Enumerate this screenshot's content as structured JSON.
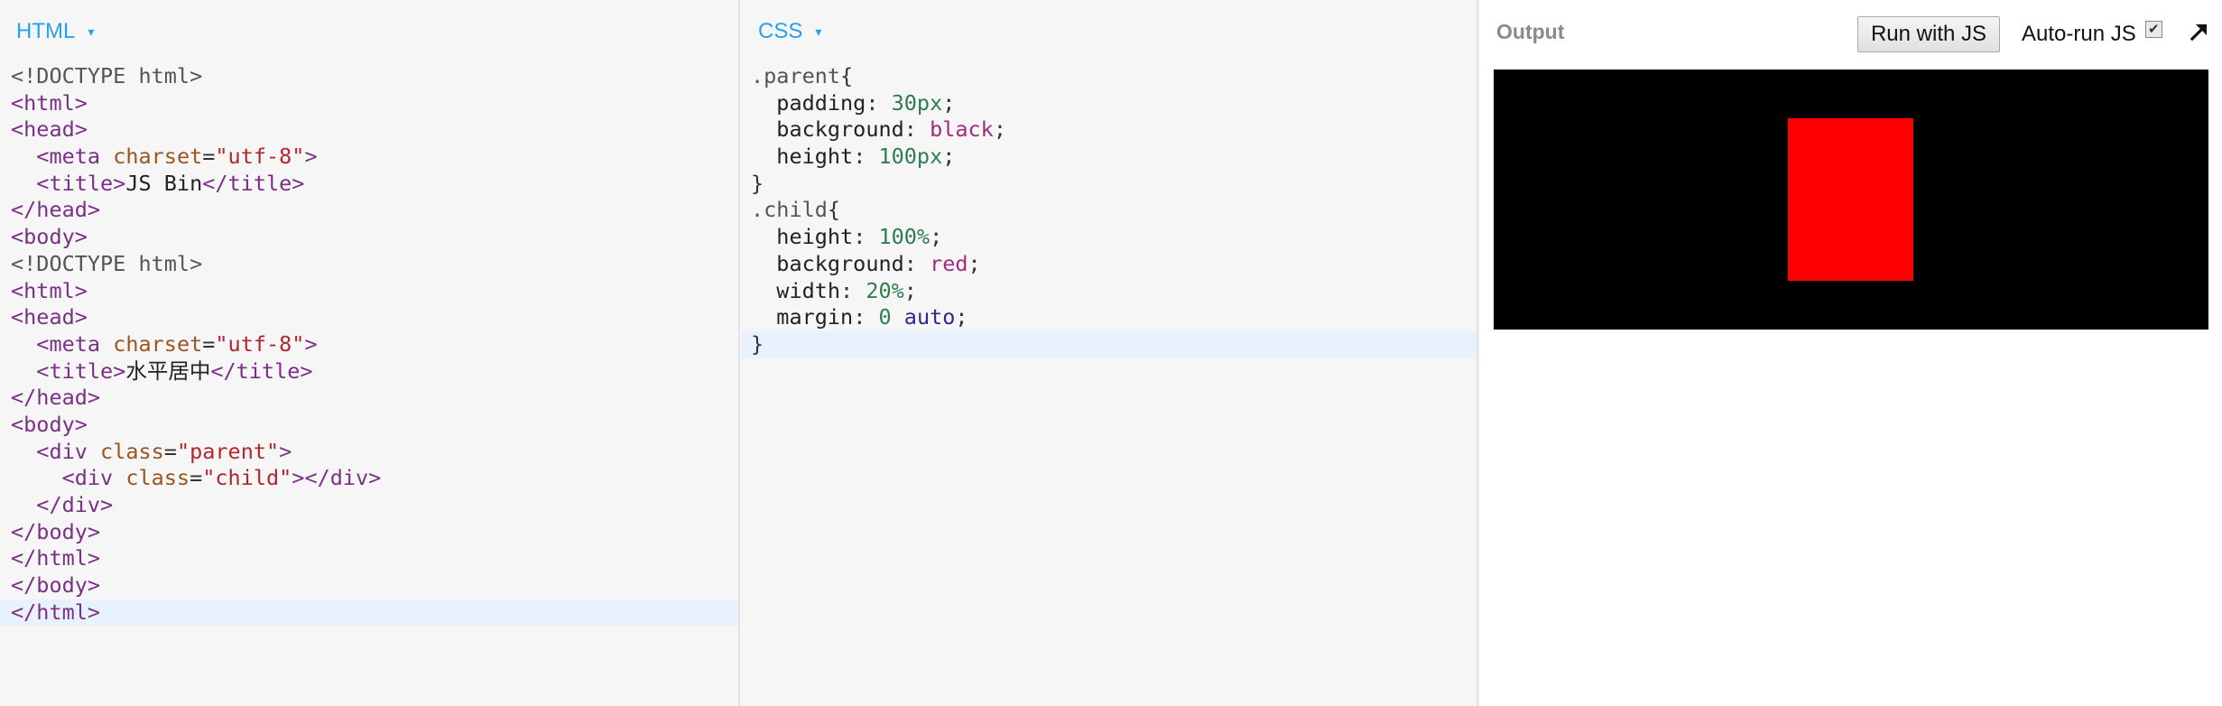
{
  "html_panel": {
    "label": "HTML",
    "arrow": "▾",
    "lines": [
      [
        {
          "t": "<!DOCTYPE html>",
          "c": "doctype"
        }
      ],
      [
        {
          "t": "<",
          "c": "tag"
        },
        {
          "t": "html",
          "c": "tag"
        },
        {
          "t": ">",
          "c": "tag"
        }
      ],
      [
        {
          "t": "<",
          "c": "tag"
        },
        {
          "t": "head",
          "c": "tag"
        },
        {
          "t": ">",
          "c": "tag"
        }
      ],
      [
        {
          "t": "  "
        },
        {
          "t": "<meta",
          "c": "tag"
        },
        {
          "t": " "
        },
        {
          "t": "charset",
          "c": "attr"
        },
        {
          "t": "=",
          "c": "eq"
        },
        {
          "t": "\"utf-8\"",
          "c": "string"
        },
        {
          "t": ">",
          "c": "tag"
        }
      ],
      [
        {
          "t": "  "
        },
        {
          "t": "<title>",
          "c": "tag"
        },
        {
          "t": "JS Bin",
          "c": "text"
        },
        {
          "t": "</title>",
          "c": "tag"
        }
      ],
      [
        {
          "t": "</head>",
          "c": "tag"
        }
      ],
      [
        {
          "t": "<body>",
          "c": "tag"
        }
      ],
      [
        {
          "t": "<!DOCTYPE html>",
          "c": "doctype"
        }
      ],
      [
        {
          "t": "<html>",
          "c": "tag"
        }
      ],
      [
        {
          "t": "<head>",
          "c": "tag"
        }
      ],
      [
        {
          "t": "  "
        },
        {
          "t": "<meta",
          "c": "tag"
        },
        {
          "t": " "
        },
        {
          "t": "charset",
          "c": "attr"
        },
        {
          "t": "=",
          "c": "eq"
        },
        {
          "t": "\"utf-8\"",
          "c": "string"
        },
        {
          "t": ">",
          "c": "tag"
        }
      ],
      [
        {
          "t": "  "
        },
        {
          "t": "<title>",
          "c": "tag"
        },
        {
          "t": "水平居中",
          "c": "text"
        },
        {
          "t": "</title>",
          "c": "tag"
        }
      ],
      [
        {
          "t": "</head>",
          "c": "tag"
        }
      ],
      [
        {
          "t": "<body>",
          "c": "tag"
        }
      ],
      [
        {
          "t": "  "
        },
        {
          "t": "<div",
          "c": "tag"
        },
        {
          "t": " "
        },
        {
          "t": "class",
          "c": "attr"
        },
        {
          "t": "=",
          "c": "eq"
        },
        {
          "t": "\"parent\"",
          "c": "string"
        },
        {
          "t": ">",
          "c": "tag"
        }
      ],
      [
        {
          "t": "    "
        },
        {
          "t": "<div",
          "c": "tag"
        },
        {
          "t": " "
        },
        {
          "t": "class",
          "c": "attr"
        },
        {
          "t": "=",
          "c": "eq"
        },
        {
          "t": "\"child\"",
          "c": "string"
        },
        {
          "t": "></div>",
          "c": "tag"
        }
      ],
      [
        {
          "t": "  "
        },
        {
          "t": "</div>",
          "c": "tag"
        }
      ],
      [
        {
          "t": "</body>",
          "c": "tag"
        }
      ],
      [
        {
          "t": "</html>",
          "c": "tag"
        }
      ],
      [
        {
          "t": "</body>",
          "c": "tag"
        }
      ],
      [
        {
          "t": "</html>",
          "c": "tag"
        }
      ]
    ],
    "active_line": 20
  },
  "css_panel": {
    "label": "CSS",
    "arrow": "▾",
    "lines": [
      [
        {
          "t": ".parent",
          "c": "selector"
        },
        {
          "t": "{",
          "c": "brace"
        }
      ],
      [
        {
          "t": "  "
        },
        {
          "t": "padding",
          "c": "prop"
        },
        {
          "t": ": ",
          "c": "punct"
        },
        {
          "t": "30px",
          "c": "number"
        },
        {
          "t": ";",
          "c": "punct"
        }
      ],
      [
        {
          "t": "  "
        },
        {
          "t": "background",
          "c": "prop"
        },
        {
          "t": ": ",
          "c": "punct"
        },
        {
          "t": "black",
          "c": "keyword"
        },
        {
          "t": ";",
          "c": "punct"
        }
      ],
      [
        {
          "t": "  "
        },
        {
          "t": "height",
          "c": "prop"
        },
        {
          "t": ": ",
          "c": "punct"
        },
        {
          "t": "100px",
          "c": "number"
        },
        {
          "t": ";",
          "c": "punct"
        }
      ],
      [
        {
          "t": "}",
          "c": "brace"
        }
      ],
      [
        {
          "t": ".child",
          "c": "selector"
        },
        {
          "t": "{",
          "c": "brace"
        }
      ],
      [
        {
          "t": "  "
        },
        {
          "t": "height",
          "c": "prop"
        },
        {
          "t": ": ",
          "c": "punct"
        },
        {
          "t": "100%",
          "c": "number"
        },
        {
          "t": ";",
          "c": "punct"
        }
      ],
      [
        {
          "t": "  "
        },
        {
          "t": "background",
          "c": "prop"
        },
        {
          "t": ": ",
          "c": "punct"
        },
        {
          "t": "red",
          "c": "keyword"
        },
        {
          "t": ";",
          "c": "punct"
        }
      ],
      [
        {
          "t": "  "
        },
        {
          "t": "width",
          "c": "prop"
        },
        {
          "t": ": ",
          "c": "punct"
        },
        {
          "t": "20%",
          "c": "number"
        },
        {
          "t": ";",
          "c": "punct"
        }
      ],
      [
        {
          "t": "  "
        },
        {
          "t": "margin",
          "c": "prop"
        },
        {
          "t": ": ",
          "c": "punct"
        },
        {
          "t": "0",
          "c": "number"
        },
        {
          "t": " "
        },
        {
          "t": "auto",
          "c": "value"
        },
        {
          "t": ";",
          "c": "punct"
        }
      ],
      [
        {
          "t": "}",
          "c": "brace"
        }
      ]
    ],
    "active_line": 10
  },
  "output_panel": {
    "title": "Output",
    "run_button_label": "Run with JS",
    "autorun_label": "Auto-run JS",
    "autorun_checked": true,
    "popout_icon": "arrow-up-right-icon",
    "preview": {
      "parent_color": "#000000",
      "child_color": "#ff0000"
    }
  },
  "colors": {
    "accent": "#26a2ea",
    "active_line": "#e8f2ff"
  }
}
